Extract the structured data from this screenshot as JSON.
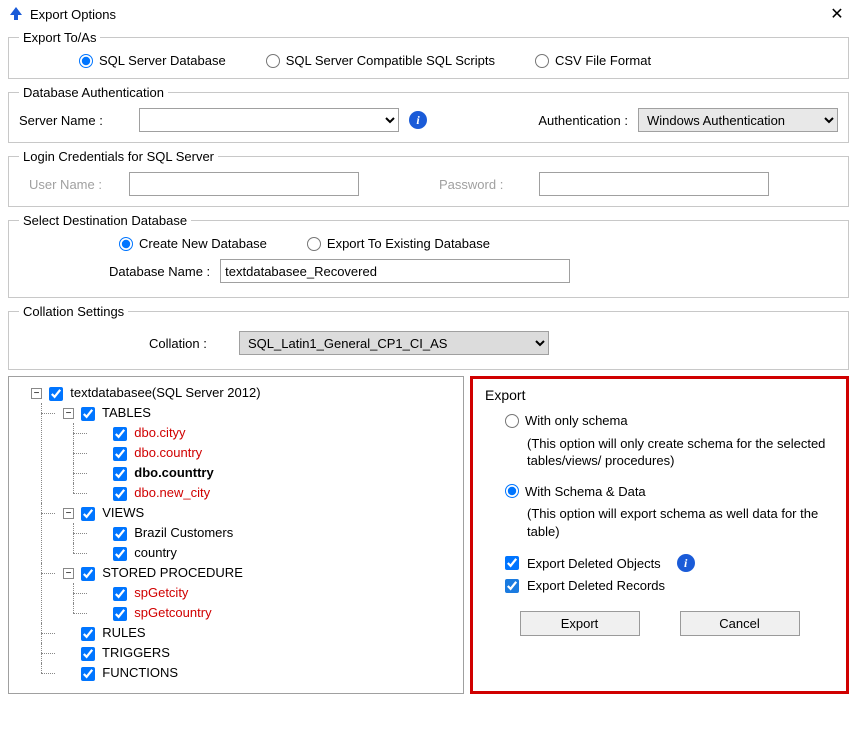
{
  "window": {
    "title": "Export Options",
    "close_glyph": "✕"
  },
  "export_to": {
    "legend": "Export To/As",
    "options": {
      "sql_db": "SQL Server Database",
      "sql_scripts": "SQL Server Compatible SQL Scripts",
      "csv": "CSV File Format"
    }
  },
  "db_auth": {
    "legend": "Database Authentication",
    "server_label": "Server Name :",
    "auth_label": "Authentication :",
    "auth_value": "Windows Authentication"
  },
  "login": {
    "legend": "Login Credentials for SQL Server",
    "user_label": "User Name :",
    "pass_label": "Password :"
  },
  "dest_db": {
    "legend": "Select Destination Database",
    "create_new": "Create New Database",
    "export_existing": "Export To Existing Database",
    "dbname_label": "Database Name :",
    "dbname_value": "textdatabasee_Recovered"
  },
  "collation": {
    "legend": "Collation Settings",
    "label": "Collation :",
    "value": "SQL_Latin1_General_CP1_CI_AS"
  },
  "tree": {
    "root": "textdatabasee(SQL Server 2012)",
    "groups": {
      "tables": "TABLES",
      "views": "VIEWS",
      "sprocs": "STORED PROCEDURE",
      "rules": "RULES",
      "triggers": "TRIGGERS",
      "functions": "FUNCTIONS"
    },
    "tables_items": [
      "dbo.cityy",
      "dbo.country",
      "dbo.counttry",
      "dbo.new_city"
    ],
    "views_items": [
      "Brazil Customers",
      "country"
    ],
    "sprocs_items": [
      "spGetcity",
      "spGetcountry"
    ]
  },
  "export_panel": {
    "legend": "Export",
    "schema_only": "With only schema",
    "schema_only_desc": "(This option will only create schema for the  selected tables/views/ procedures)",
    "schema_data": "With Schema & Data",
    "schema_data_desc": "(This option will export schema as well data for the table)",
    "deleted_objects": "Export Deleted Objects",
    "deleted_records": "Export Deleted Records",
    "export_btn": "Export",
    "cancel_btn": "Cancel"
  }
}
